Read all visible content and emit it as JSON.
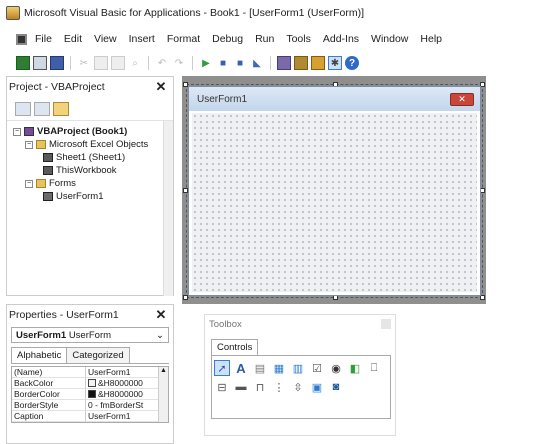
{
  "window": {
    "title": "Microsoft Visual Basic for Applications - Book1 - [UserForm1 (UserForm)]"
  },
  "menu": [
    "File",
    "Edit",
    "View",
    "Insert",
    "Format",
    "Debug",
    "Run",
    "Tools",
    "Add-Ins",
    "Window",
    "Help"
  ],
  "project": {
    "title": "Project - VBAProject",
    "close": "✕",
    "tree": {
      "root": "VBAProject (Book1)",
      "excel_objects": "Microsoft Excel Objects",
      "sheet1": "Sheet1 (Sheet1)",
      "thisworkbook": "ThisWorkbook",
      "forms": "Forms",
      "userform1": "UserForm1"
    }
  },
  "properties": {
    "title": "Properties - UserForm1",
    "close": "✕",
    "object_name": "UserForm1",
    "object_type": "UserForm",
    "tabs": [
      "Alphabetic",
      "Categorized"
    ],
    "rows": [
      {
        "key": "(Name)",
        "value": "UserForm1"
      },
      {
        "key": "BackColor",
        "value": "&H8000000"
      },
      {
        "key": "BorderColor",
        "value": "&H8000000"
      },
      {
        "key": "BorderStyle",
        "value": "0 - fmBorderSt"
      },
      {
        "key": "Caption",
        "value": "UserForm1"
      }
    ],
    "swatch_colors": {
      "backcolor": "#f2f2f2",
      "bordercolor": "#111111"
    }
  },
  "userform": {
    "title": "UserForm1",
    "close": "✕"
  },
  "toolbox": {
    "title": "Toolbox",
    "tab": "Controls"
  }
}
